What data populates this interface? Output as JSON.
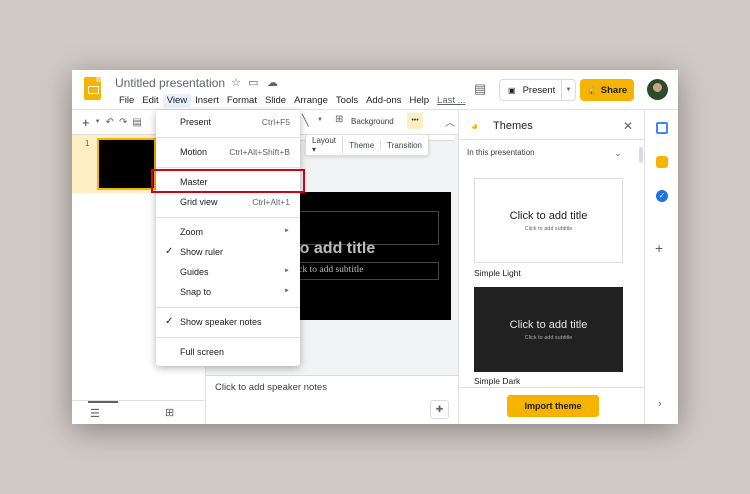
{
  "header": {
    "title": "Untitled presentation",
    "menu": [
      "File",
      "Edit",
      "View",
      "Insert",
      "Format",
      "Slide",
      "Arrange",
      "Tools",
      "Add-ons",
      "Help",
      "Last ..."
    ],
    "present_label": "Present",
    "share_label": "Share"
  },
  "toolbar": {
    "background_label": "Background",
    "more_label": "•••"
  },
  "subtoolbar": {
    "layout_label": "Layout",
    "theme_label": "Theme",
    "transition_label": "Transition"
  },
  "filmstrip": {
    "slide_number": "1"
  },
  "slide": {
    "title": "k to add title",
    "subtitle": "lick to add subtitle"
  },
  "notes": {
    "placeholder": "Click to add speaker notes"
  },
  "view_menu": {
    "items": [
      {
        "label": "Present",
        "shortcut": "Ctrl+F5"
      },
      {
        "label": "Motion",
        "shortcut": "Ctrl+Alt+Shift+B"
      },
      {
        "label": "Master",
        "shortcut": ""
      },
      {
        "label": "Grid view",
        "shortcut": "Ctrl+Alt+1"
      },
      {
        "label": "Zoom",
        "shortcut": ""
      },
      {
        "label": "Show ruler",
        "shortcut": ""
      },
      {
        "label": "Guides",
        "shortcut": ""
      },
      {
        "label": "Snap to",
        "shortcut": ""
      },
      {
        "label": "Show speaker notes",
        "shortcut": ""
      },
      {
        "label": "Full screen",
        "shortcut": ""
      }
    ]
  },
  "themes": {
    "title": "Themes",
    "section": "In this presentation",
    "cards": [
      {
        "name": "Simple Light",
        "title": "Click to add title",
        "subtitle": "Click to add subtitle"
      },
      {
        "name": "Simple Dark",
        "title": "Click to add title",
        "subtitle": "Click to add subtitle"
      }
    ],
    "import_label": "Import theme"
  },
  "colors": {
    "accent": "#f6b400",
    "highlight_box": "#d0021b"
  }
}
